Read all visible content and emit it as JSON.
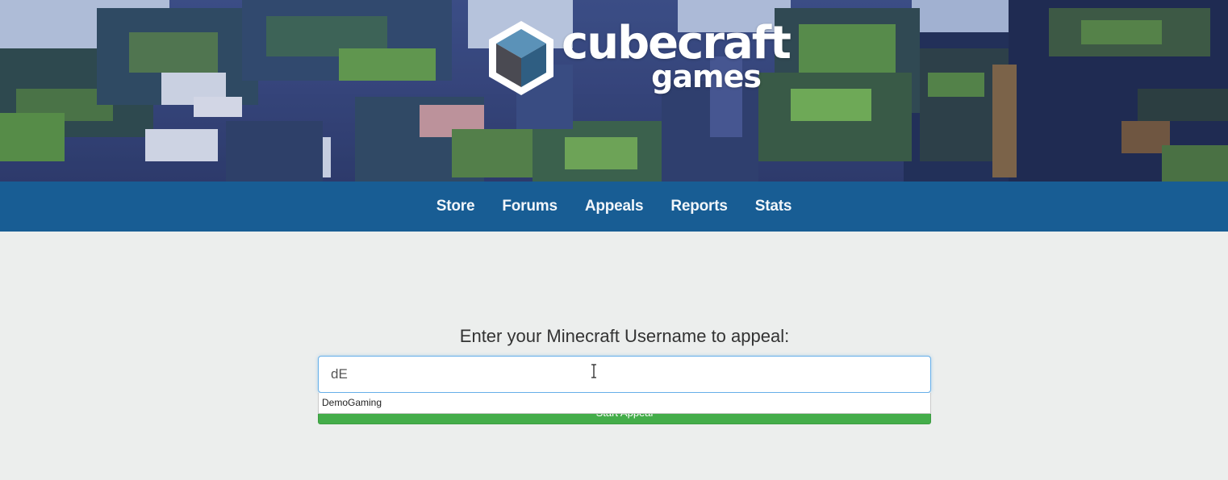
{
  "header": {
    "logo_word": "cubecraft",
    "logo_sub": "games"
  },
  "nav": {
    "items": [
      "Store",
      "Forums",
      "Appeals",
      "Reports",
      "Stats"
    ]
  },
  "main": {
    "prompt": "Enter your Minecraft Username to appeal:",
    "username_value": "dE",
    "submit_label": "Start Appeal",
    "suggestions": [
      "DemoGaming"
    ]
  },
  "colors": {
    "nav_bg": "#185d94",
    "page_bg": "#eceeed",
    "button_green": "#44ad4a",
    "input_focus": "#66afe9"
  }
}
